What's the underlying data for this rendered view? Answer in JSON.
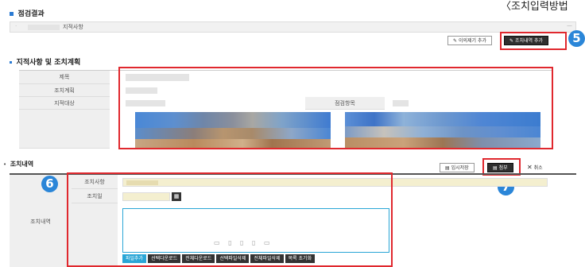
{
  "page": {
    "title": "점검결과",
    "method_label": "〈조치입력방법"
  },
  "finding_bar": {
    "label": "지적사항",
    "collapse_glyph": "—"
  },
  "action_buttons": {
    "objection_add": "이의제기 추가",
    "measure_add": "조치내역 추가"
  },
  "plan_section": {
    "title": "지적사항 및 조치계획",
    "rows": {
      "subject": "제목",
      "plan": "조치계획",
      "target": "지적대상",
      "check_item": "점검항목"
    }
  },
  "measure_section": {
    "title": "조치내역",
    "temp_save": "임시저장",
    "attach": "첨부",
    "cancel": "취소",
    "side_label": "조치내역",
    "rows": {
      "item": "조치사항",
      "date": "조치일"
    },
    "file_buttons": [
      "파일추가",
      "선택다운로드",
      "전체다운로드",
      "선택파일삭제",
      "전체파일삭제",
      "목록 초기화"
    ]
  },
  "callouts": [
    "5",
    "6",
    "7"
  ],
  "colors": {
    "accent": "#2b7bd3",
    "highlight": "#e0282e",
    "callout": "#2b86d8",
    "input_yellow": "#f4efcf"
  },
  "icons": [
    "pencil-icon",
    "save-icon",
    "close-icon",
    "calendar-icon",
    "file-icon"
  ]
}
